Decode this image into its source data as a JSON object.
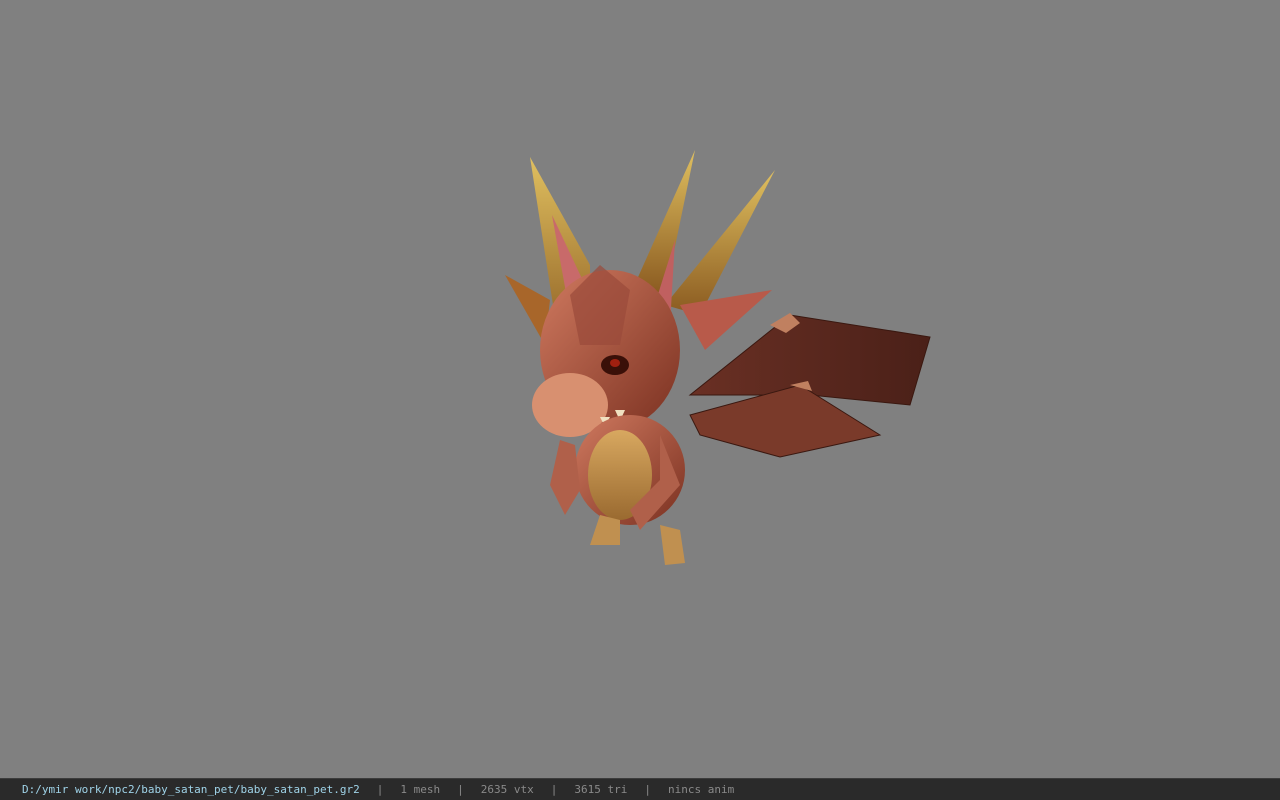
{
  "viewport": {
    "background": "#808080",
    "model_icon": "dragon-model"
  },
  "status_bar": {
    "file_path": "D:/ymir work/npc2/baby_satan_pet/baby_satan_pet.gr2",
    "separator": "|",
    "mesh_count": "1 mesh",
    "vertex_count": "2635 vtx",
    "triangle_count": "3615 tri",
    "anim_status": "nincs anim",
    "path_color": "#9fd3e8",
    "text_color": "#8a8a8a"
  }
}
